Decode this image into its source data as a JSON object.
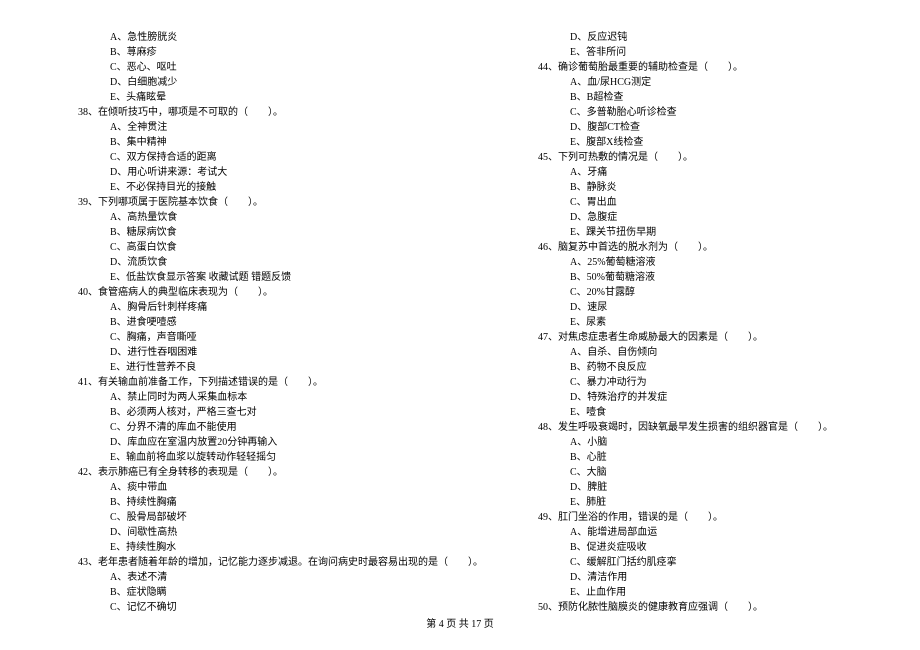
{
  "left": [
    {
      "t": "opt",
      "text": "A、急性膀胱炎"
    },
    {
      "t": "opt",
      "text": "B、荨麻疹"
    },
    {
      "t": "opt",
      "text": "C、恶心、呕吐"
    },
    {
      "t": "opt",
      "text": "D、白细胞减少"
    },
    {
      "t": "opt",
      "text": "E、头痛眩晕"
    },
    {
      "t": "q",
      "text": "38、在倾听技巧中，哪项是不可取的（　　）。"
    },
    {
      "t": "opt",
      "text": "A、全神贯注"
    },
    {
      "t": "opt",
      "text": "B、集中精神"
    },
    {
      "t": "opt",
      "text": "C、双方保持合适的距离"
    },
    {
      "t": "opt",
      "text": "D、用心听讲来源：考试大"
    },
    {
      "t": "opt",
      "text": "E、不必保持目光的接触"
    },
    {
      "t": "q",
      "text": "39、下列哪项属于医院基本饮食（　　）。"
    },
    {
      "t": "opt",
      "text": "A、高热量饮食"
    },
    {
      "t": "opt",
      "text": "B、糖尿病饮食"
    },
    {
      "t": "opt",
      "text": "C、高蛋白饮食"
    },
    {
      "t": "opt",
      "text": "D、流质饮食"
    },
    {
      "t": "opt",
      "text": "E、低盐饮食显示答案  收藏试题  错题反馈"
    },
    {
      "t": "q",
      "text": "40、食管癌病人的典型临床表现为（　　）。"
    },
    {
      "t": "opt",
      "text": "A、胸骨后针刺样疼痛"
    },
    {
      "t": "opt",
      "text": "B、进食哽噎感"
    },
    {
      "t": "opt",
      "text": "C、胸痛，声音嘶哑"
    },
    {
      "t": "opt",
      "text": "D、进行性吞咽困难"
    },
    {
      "t": "opt",
      "text": "E、进行性营养不良"
    },
    {
      "t": "q",
      "text": "41、有关输血前准备工作，下列描述错误的是（　　）。"
    },
    {
      "t": "opt",
      "text": "A、禁止同时为两人采集血标本"
    },
    {
      "t": "opt",
      "text": "B、必须两人核对，严格三查七对"
    },
    {
      "t": "opt",
      "text": "C、分界不清的库血不能使用"
    },
    {
      "t": "opt",
      "text": "D、库血应在室温内放置20分钟再输入"
    },
    {
      "t": "opt",
      "text": "E、输血前将血浆以旋转动作轻轻摇匀"
    },
    {
      "t": "q",
      "text": "42、表示肺癌已有全身转移的表现是（　　）。"
    },
    {
      "t": "opt",
      "text": "A、痰中带血"
    },
    {
      "t": "opt",
      "text": "B、持续性胸痛"
    },
    {
      "t": "opt",
      "text": "C、股骨局部破坏"
    },
    {
      "t": "opt",
      "text": "D、间歇性高热"
    },
    {
      "t": "opt",
      "text": "E、持续性胸水"
    },
    {
      "t": "q",
      "text": "43、老年患者随着年龄的增加，记忆能力逐步减退。在询问病史时最容易出现的是（　　）。"
    },
    {
      "t": "opt",
      "text": "A、表述不清"
    },
    {
      "t": "opt",
      "text": "B、症状隐瞒"
    },
    {
      "t": "opt",
      "text": "C、记忆不确切"
    }
  ],
  "right": [
    {
      "t": "opt",
      "text": "D、反应迟钝"
    },
    {
      "t": "opt",
      "text": "E、答非所问"
    },
    {
      "t": "q",
      "text": "44、确诊葡萄胎最重要的辅助检查是（　　）。"
    },
    {
      "t": "opt",
      "text": "A、血/尿HCG测定"
    },
    {
      "t": "opt",
      "text": "B、B超检查"
    },
    {
      "t": "opt",
      "text": "C、多普勒胎心听诊检查"
    },
    {
      "t": "opt",
      "text": "D、腹部CT检查"
    },
    {
      "t": "opt",
      "text": "E、腹部X线检查"
    },
    {
      "t": "q",
      "text": "45、下列可热敷的情况是（　　）。"
    },
    {
      "t": "opt",
      "text": "A、牙痛"
    },
    {
      "t": "opt",
      "text": "B、静脉炎"
    },
    {
      "t": "opt",
      "text": "C、胃出血"
    },
    {
      "t": "opt",
      "text": "D、急腹症"
    },
    {
      "t": "opt",
      "text": "E、踝关节扭伤早期"
    },
    {
      "t": "q",
      "text": "46、脑复苏中首选的脱水剂为（　　）。"
    },
    {
      "t": "opt",
      "text": "A、25%葡萄糖溶液"
    },
    {
      "t": "opt",
      "text": "B、50%葡萄糖溶液"
    },
    {
      "t": "opt",
      "text": "C、20%甘露醇"
    },
    {
      "t": "opt",
      "text": "D、速尿"
    },
    {
      "t": "opt",
      "text": "E、尿素"
    },
    {
      "t": "q",
      "text": "47、对焦虑症患者生命威胁最大的因素是（　　）。"
    },
    {
      "t": "opt",
      "text": "A、自杀、自伤倾向"
    },
    {
      "t": "opt",
      "text": "B、药物不良反应"
    },
    {
      "t": "opt",
      "text": "C、暴力冲动行为"
    },
    {
      "t": "opt",
      "text": "D、特殊治疗的并发症"
    },
    {
      "t": "opt",
      "text": "E、噎食"
    },
    {
      "t": "q",
      "text": "48、发生呼吸衰竭时，因缺氧最早发生损害的组织器官是（　　）。"
    },
    {
      "t": "opt",
      "text": "A、小脑"
    },
    {
      "t": "opt",
      "text": "B、心脏"
    },
    {
      "t": "opt",
      "text": "C、大脑"
    },
    {
      "t": "opt",
      "text": "D、脾脏"
    },
    {
      "t": "opt",
      "text": "E、肺脏"
    },
    {
      "t": "q",
      "text": "49、肛门坐浴的作用，错误的是（　　）。"
    },
    {
      "t": "opt",
      "text": "A、能增进局部血运"
    },
    {
      "t": "opt",
      "text": "B、促进炎症吸收"
    },
    {
      "t": "opt",
      "text": "C、缓解肛门括约肌痉挛"
    },
    {
      "t": "opt",
      "text": "D、清洁作用"
    },
    {
      "t": "opt",
      "text": "E、止血作用"
    },
    {
      "t": "q",
      "text": "50、预防化脓性脑膜炎的健康教育应强调（　　）。"
    }
  ],
  "footer": "第 4 页 共 17 页"
}
